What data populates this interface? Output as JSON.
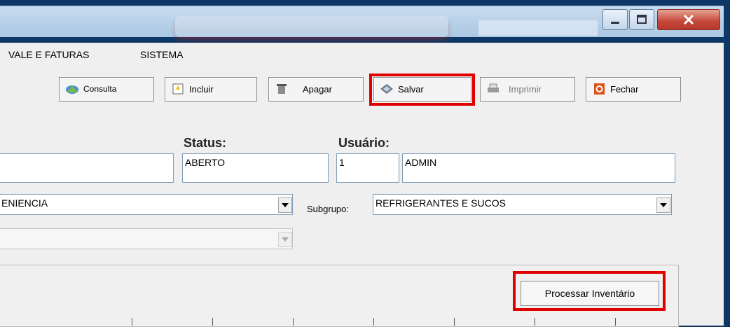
{
  "menu": {
    "items": [
      "VALE E FATURAS",
      "SISTEMA"
    ]
  },
  "toolbar": {
    "consulta": "Consulta",
    "incluir": "Incluir",
    "apagar": "Apagar",
    "salvar": "Salvar",
    "imprimir": "Imprimir",
    "fechar": "Fechar"
  },
  "form": {
    "status_label": "Status:",
    "status_value": "ABERTO",
    "usuario_label": "Usuário:",
    "usuario_id": "1",
    "usuario_name": "ADMIN",
    "grupo_value": "ENIENCIA",
    "subgrupo_label": "Subgrupo:",
    "subgrupo_value": "REFRIGERANTES E SUCOS",
    "third_combo_value": ""
  },
  "actions": {
    "processar": "Processar Inventário"
  },
  "colors": {
    "highlight": "#e00000",
    "window_bg": "#0d3866",
    "client_bg": "#efefef"
  }
}
